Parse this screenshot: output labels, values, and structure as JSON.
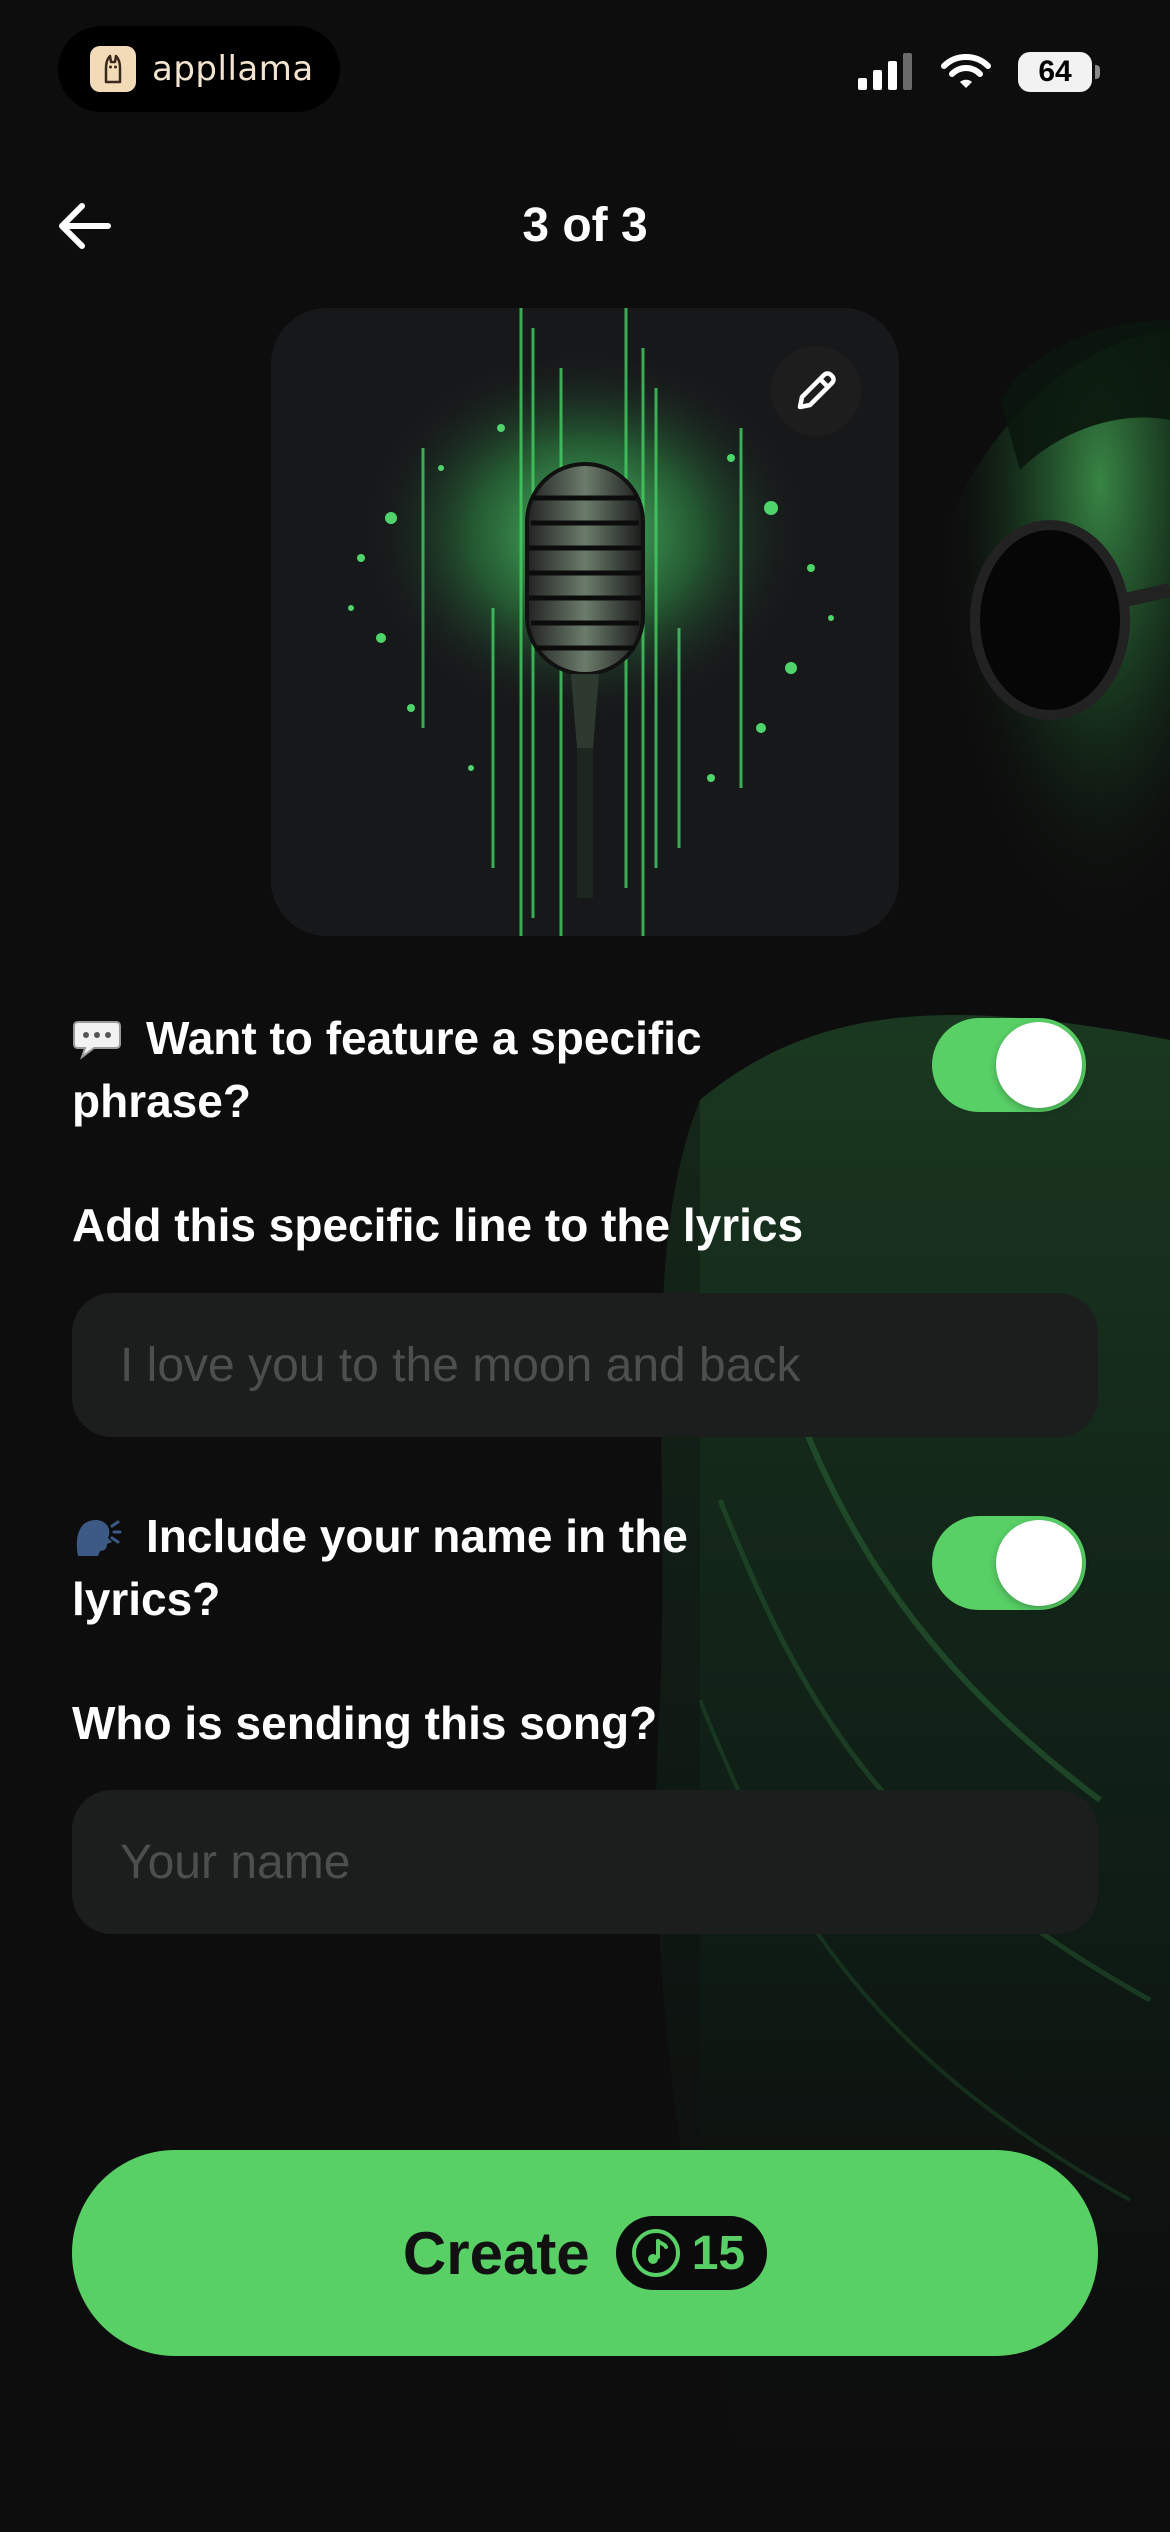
{
  "status_bar": {
    "brand": "appllama",
    "battery": "64",
    "icons": [
      "cellular-signal-icon",
      "wifi-icon",
      "battery-icon"
    ]
  },
  "header": {
    "title": "3 of 3",
    "back_icon": "arrow-left-icon"
  },
  "cover": {
    "edit_icon": "pencil-icon"
  },
  "phrase_section": {
    "emoji": "💬",
    "question": "Want to feature a specific phrase?",
    "toggle_on": true,
    "field_label": "Add this specific line to the lyrics",
    "placeholder": "I love you to the moon and back",
    "value": ""
  },
  "name_section": {
    "emoji": "🗣️",
    "question": "Include your name in the lyrics?",
    "toggle_on": true,
    "field_label": "Who is sending this song?",
    "placeholder": "Your name",
    "value": ""
  },
  "create_button": {
    "label": "Create",
    "credit_icon": "music-note-icon",
    "credits": "15"
  },
  "colors": {
    "accent": "#58d066",
    "background": "#0d0d0d",
    "input_background": "#1c1e1e"
  }
}
